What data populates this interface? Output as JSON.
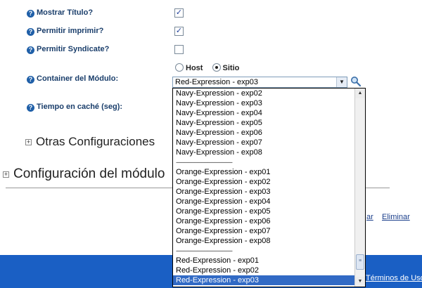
{
  "form": {
    "show_title": {
      "label": "Mostrar Título?",
      "checked": true
    },
    "allow_print": {
      "label": "Permitir imprimir?",
      "checked": true
    },
    "allow_syndicate": {
      "label": "Permitir Syndicate?",
      "checked": false
    },
    "scope": {
      "host_label": "Host",
      "site_label": "Sitio",
      "selected": "Sitio"
    },
    "container": {
      "label": "Container del Módulo:",
      "selected_value": "Red-Expression - exp03"
    },
    "cache_time": {
      "label": "Tiempo en caché (seg):"
    },
    "check_glyph": "✓",
    "help_glyph": "?"
  },
  "sections": {
    "other_settings": "Otras Configuraciones",
    "module_settings": "Configuración del módulo",
    "expand_glyph": "+"
  },
  "links": {
    "update": "ar",
    "delete": "Eliminar"
  },
  "footer": {
    "terms": "Términos de Uso"
  },
  "dropdown": {
    "separator": "----------------------------------------",
    "items": [
      "Navy-Expression - exp02",
      "Navy-Expression - exp03",
      "Navy-Expression - exp04",
      "Navy-Expression - exp05",
      "Navy-Expression - exp06",
      "Navy-Expression - exp07",
      "Navy-Expression - exp08",
      "----------------------------------------",
      "Orange-Expression - exp01",
      "Orange-Expression - exp02",
      "Orange-Expression - exp03",
      "Orange-Expression - exp04",
      "Orange-Expression - exp05",
      "Orange-Expression - exp06",
      "Orange-Expression - exp07",
      "Orange-Expression - exp08",
      "----------------------------------------",
      "Red-Expression - exp01",
      "Red-Expression - exp02",
      "Red-Expression - exp03"
    ],
    "selected_index": 19
  },
  "icons": {
    "dropdown_arrow": "chevron-down-icon",
    "search": "magnifier-icon",
    "help": "help-icon"
  }
}
